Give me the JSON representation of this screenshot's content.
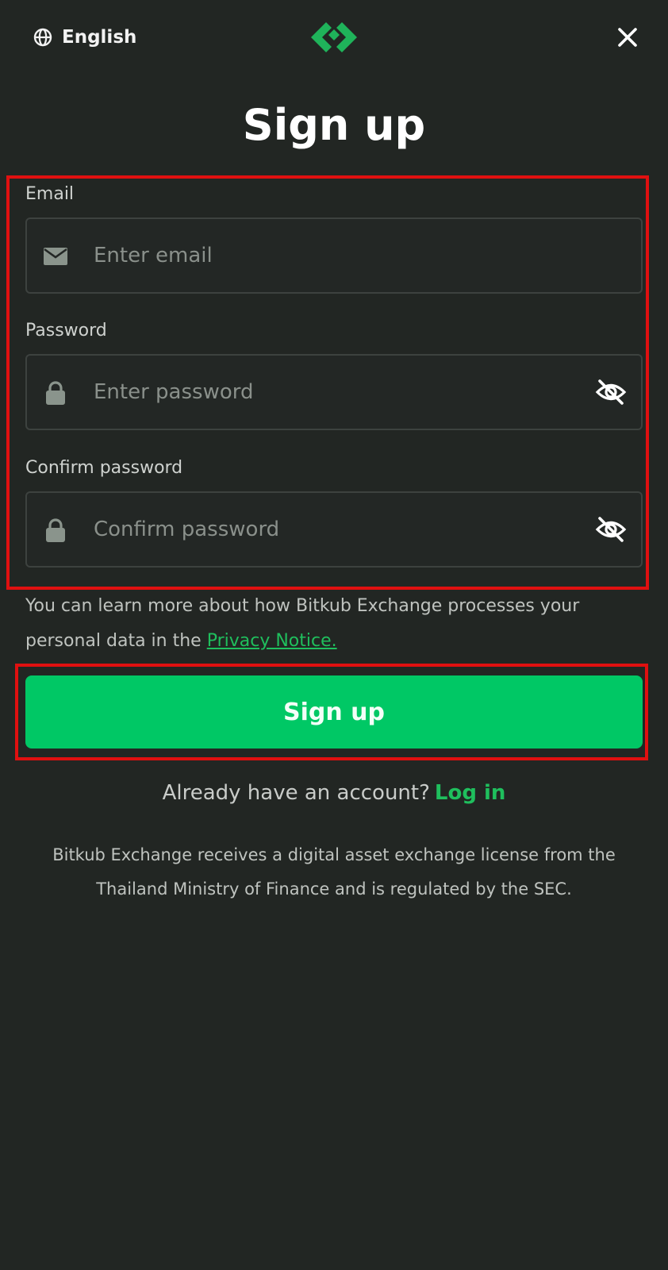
{
  "header": {
    "language_label": "English",
    "language_icon": "globe-icon",
    "logo_icon": "bitkub-logo-icon",
    "close_icon": "close-icon"
  },
  "page": {
    "title": "Sign up"
  },
  "form": {
    "email": {
      "label": "Email",
      "placeholder": "Enter email",
      "value": "",
      "icon": "envelope-icon"
    },
    "password": {
      "label": "Password",
      "placeholder": "Enter password",
      "value": "",
      "icon": "lock-icon",
      "toggle_icon": "eye-off-icon"
    },
    "confirm_password": {
      "label": "Confirm password",
      "placeholder": "Confirm password",
      "value": "",
      "icon": "lock-icon",
      "toggle_icon": "eye-off-icon"
    }
  },
  "privacy": {
    "text": "You can learn more about how Bitkub Exchange processes your personal data in the ",
    "link_label": "Privacy Notice."
  },
  "actions": {
    "signup_label": "Sign up"
  },
  "login_prompt": {
    "text": "Already have an account?",
    "link_label": "Log in"
  },
  "footer": {
    "license_text": "Bitkub Exchange receives a digital asset exchange license from the Thailand Ministry of Finance and is regulated by the SEC."
  },
  "colors": {
    "background": "#222623",
    "accent": "#00c865",
    "highlight": "#e01010"
  }
}
